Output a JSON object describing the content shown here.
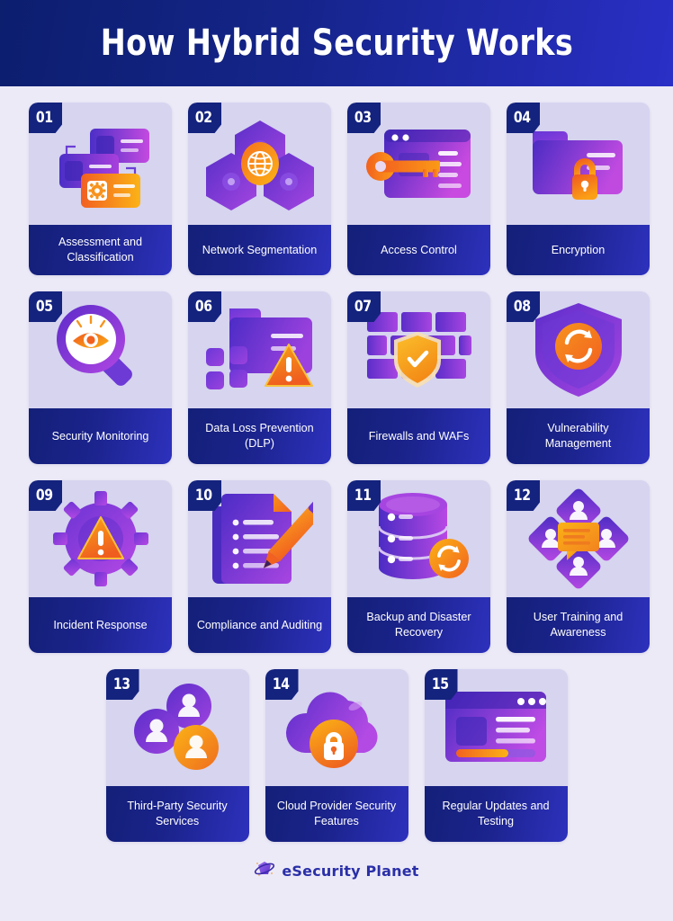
{
  "header": {
    "title": "How Hybrid Security Works",
    "gradient_start": "#0c1e6e",
    "gradient_end": "#2a2fc6"
  },
  "theme": {
    "page_background": "#eceaf7",
    "card_art_background": "#d6d4ef",
    "label_navy": "#14237e",
    "label_indigo": "#2d31bd",
    "accent_orange": "#f7931e",
    "accent_purple": "#7b3fe4",
    "accent_magenta": "#c04ae0"
  },
  "cards": [
    {
      "number": "01",
      "label": "Assessment and Classification",
      "icon": "server-stack-config-icon"
    },
    {
      "number": "02",
      "label": "Network Segmentation",
      "icon": "hexagon-network-globe-icon"
    },
    {
      "number": "03",
      "label": "Access Control",
      "icon": "browser-key-icon"
    },
    {
      "number": "04",
      "label": "Encryption",
      "icon": "folder-lock-icon"
    },
    {
      "number": "05",
      "label": "Security Monitoring",
      "icon": "magnifier-eye-icon"
    },
    {
      "number": "06",
      "label": "Data Loss Prevention (DLP)",
      "icon": "folder-warning-icon"
    },
    {
      "number": "07",
      "label": "Firewalls and WAFs",
      "icon": "brick-wall-shield-check-icon"
    },
    {
      "number": "08",
      "label": "Vulnerability Management",
      "icon": "shield-refresh-icon"
    },
    {
      "number": "09",
      "label": "Incident Response",
      "icon": "gear-warning-icon"
    },
    {
      "number": "10",
      "label": "Compliance and Auditing",
      "icon": "document-pencil-icon"
    },
    {
      "number": "11",
      "label": "Backup and Disaster Recovery",
      "icon": "database-sync-icon"
    },
    {
      "number": "12",
      "label": "User Training and Awareness",
      "icon": "users-diamond-chat-icon"
    },
    {
      "number": "13",
      "label": "Third-Party Security Services",
      "icon": "user-network-nodes-icon"
    },
    {
      "number": "14",
      "label": "Cloud Provider Security Features",
      "icon": "cloud-lock-icon"
    },
    {
      "number": "15",
      "label": "Regular Updates and Testing",
      "icon": "browser-progress-icon"
    }
  ],
  "footer": {
    "brand": "eSecurity Planet",
    "logo_icon": "planet-ring-icon"
  }
}
